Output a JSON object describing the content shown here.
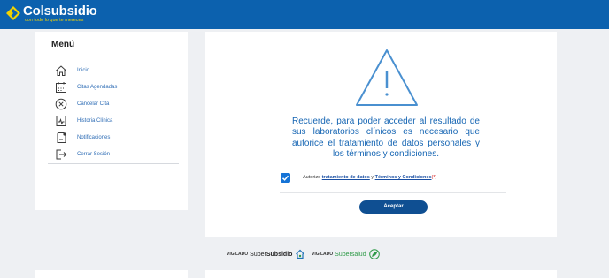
{
  "header": {
    "brand_name": "Colsubsidio",
    "slogan": "con todo lo que te mereces",
    "brand_color": "#0c61ae",
    "slogan_color": "#f2d200"
  },
  "sidebar": {
    "title": "Menú",
    "items": [
      {
        "label": "Inicio",
        "icon": "home-icon"
      },
      {
        "label": "Citas Agendadas",
        "icon": "calendar-icon"
      },
      {
        "label": "Cancelar Cita",
        "icon": "cancel-circle-icon"
      },
      {
        "label": "Historia Clínica",
        "icon": "clinical-history-icon"
      },
      {
        "label": "Notificaciones",
        "icon": "notification-icon"
      },
      {
        "label": "Cerrar Sesión",
        "icon": "logout-icon"
      }
    ]
  },
  "main": {
    "warning_icon": "warning-triangle-icon",
    "notice": "Recuerde, para poder acceder al resultado de sus laboratorios clínicos es necesario que autorice el tratamiento de datos personales y los términos y condiciones.",
    "consent": {
      "checked": true,
      "prefix": "Autorizo",
      "link1": "tratamiento de datos",
      "connector": "y",
      "link2": "Términos y Condiciones",
      "required_mark": "(*)"
    },
    "accept_label": "Aceptar"
  },
  "footer": {
    "vigilado1_prefix": "VIGILADO",
    "vigilado1_brand_light": "Super",
    "vigilado1_brand_bold": "Subsidio",
    "vigilado2_prefix": "VIGILADO",
    "vigilado2_brand": "Supersalud"
  },
  "colors": {
    "accent": "#1565b3",
    "button": "#0f4f92",
    "checkbox": "#1573d6",
    "required": "#d42020",
    "supersalud": "#2e9a47"
  }
}
